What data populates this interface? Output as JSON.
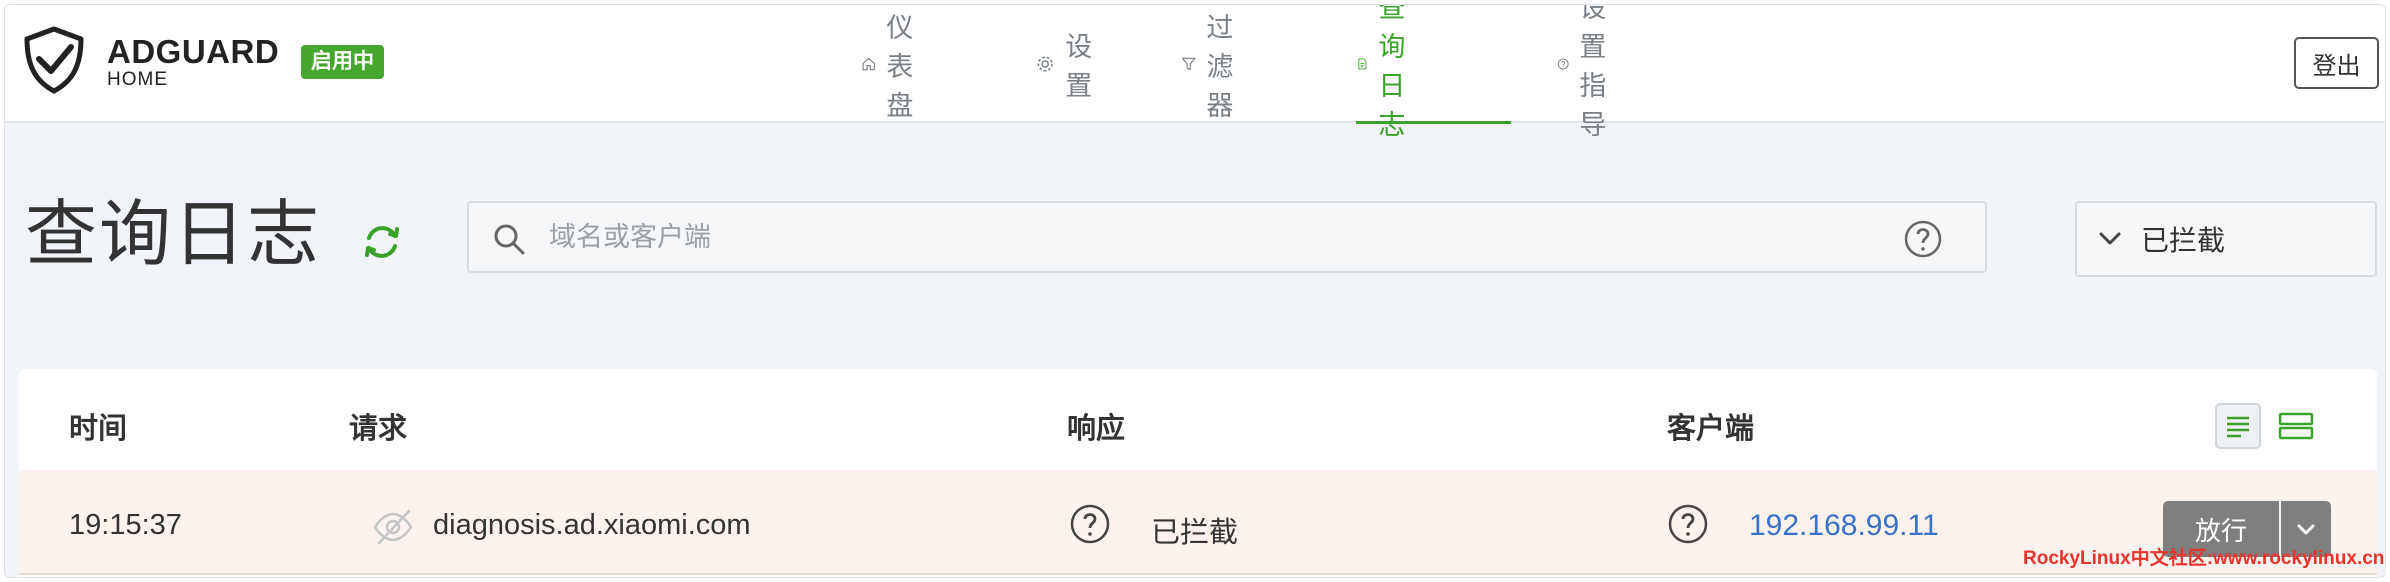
{
  "brand": {
    "title": "ADGUARD",
    "subtitle": "HOME",
    "status_badge": "启用中"
  },
  "nav": [
    {
      "label": "仪表盘",
      "icon": "home-icon",
      "active": false
    },
    {
      "label": "设置",
      "icon": "gear-icon",
      "active": false
    },
    {
      "label": "过滤器",
      "icon": "filter-icon",
      "active": false
    },
    {
      "label": "查询日志",
      "icon": "document-icon",
      "active": true
    },
    {
      "label": "设置指导",
      "icon": "help-circle-icon",
      "active": false
    }
  ],
  "logout_label": "登出",
  "page": {
    "title": "查询日志",
    "search_placeholder": "域名或客户端",
    "filter_value": "已拦截"
  },
  "table": {
    "headers": {
      "time": "时间",
      "request": "请求",
      "response": "响应",
      "client": "客户端"
    },
    "rows": [
      {
        "time": "19:15:37",
        "domain": "diagnosis.ad.xiaomi.com",
        "response": "已拦截",
        "client": "192.168.99.11",
        "action": "放行"
      }
    ]
  },
  "watermark": "RockyLinux中文社区:www.rockylinux.cn",
  "colors": {
    "accent": "#3aa22a",
    "badge": "#46a72e",
    "link": "#3a72c7",
    "blocked_row": "#fcf2ee",
    "action_button": "#7f7f7f"
  }
}
